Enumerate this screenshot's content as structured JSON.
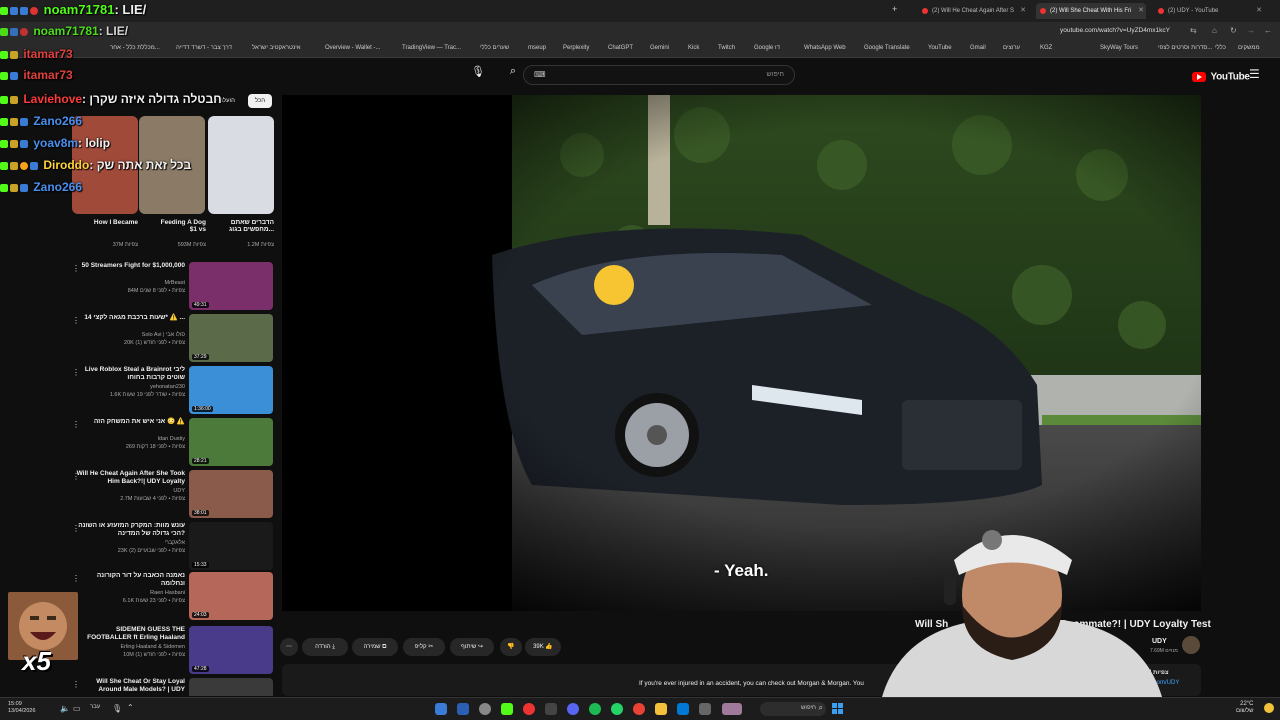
{
  "browser": {
    "tabs": [
      {
        "label": "(2) Will He Cheat Again After S"
      },
      {
        "label": "(2) Will She Cheat With His Fri"
      },
      {
        "label": "(2) UDY - YouTube"
      }
    ],
    "address": "youtube.com/watch?v=UyZD4mx1kcY",
    "bookmarks": [
      "ממשקים",
      "כללי",
      "סדרות וסרטים לצפי...",
      "SkyWay Tours",
      "KGZ",
      "ערוצים",
      "Gmail",
      "YouTube",
      "Google Translate",
      "WhatsApp Web",
      "Google דוּ",
      "Twitch",
      "Kick",
      "Gemini",
      "ChatGPT",
      "Perplexity",
      "mseup",
      "שערים כללי",
      "TradingView — Trac...",
      "Overview - Wallet -...",
      "אינטראקטיב ישראל",
      "דרך צבר - דשרד דדייה",
      "מכללת כלל - אחר..."
    ]
  },
  "youtube": {
    "logo": "YouTube",
    "search_placeholder": "חיפוש",
    "chip_all": "הכל",
    "chip_uploaded": "הועלה ע",
    "top_cards": [
      {
        "title": "How I Became",
        "views": "37M צפיות"
      },
      {
        "title": "Feeding A Dog $1 vs",
        "views": "593M צפיות"
      },
      {
        "title": "הדברים שאתם מחפשים בגוג...",
        "views": "1.2M צפיות"
      }
    ],
    "sidebar_videos": [
      {
        "title": "50 Streamers Fight for $1,000,000",
        "channel": "MrBeast",
        "meta": "84M צפיות • לפני 8 שנים",
        "duration": "49:31"
      },
      {
        "title": "14 שעות ברכבת מגאה לקצי* ⚠️ ...",
        "channel": "Solo Avi | סולו אבי",
        "meta": "20K צפיות • לפני חודש (1)",
        "duration": "37:29"
      },
      {
        "title": "Live Roblox Steal a Brainrot ליבי שוטים קרבות בחוחו",
        "channel": "yehonatan230",
        "meta": "1.6K צפיות • שודר לפני 19 שעות",
        "duration": "1:36:00"
      },
      {
        "title": "אני איש את המשחק הזה 😳 ⚠️",
        "channel": "Idan Dustiy",
        "meta": "269 צפיות • לפני 18 דקות",
        "duration": "28:21"
      },
      {
        "title": "Will He Cheat Again After She Took Him Back?!| UDY Loyalty",
        "channel": "UDY",
        "meta": "2.7M צפיות • לפני 4 שבועות",
        "duration": "38:01"
      },
      {
        "title": "עונש מוות: המקרק המזעזע או השונה הכי גדולה של המדינה?",
        "channel": "אלאקברי",
        "meta": "23K צפיות • לפני שבועיים (2)",
        "duration": "15:33"
      },
      {
        "title": "נאמנה הכאבה על דור הקורונה ונחלומה",
        "channel": "Raen Hasbani",
        "meta": "6.1K צפיות • לפני 23 שעות",
        "duration": "24:03"
      },
      {
        "title": "SIDEMEN GUESS THE FOOTBALLER ft Erling Haaland",
        "channel": "Erling Haaland & Sidemen",
        "meta": "10M צפיות • לפני חודש (1)",
        "duration": "47:28"
      },
      {
        "title": "Will She Cheat Or Stay Loyal Around Male Models? | UDY",
        "channel": "",
        "meta": "",
        "duration": ""
      }
    ],
    "video_title": "Will She Cheat With His Friend's Roommate?! | UDY Loyalty Test",
    "video_title_left": "Will Sh",
    "video_title_right": "Roommate?! | UDY Loyalty Test",
    "subtitle": "- Yeah.",
    "channel_name": "UDY",
    "subscribers": "7.69M מנויים",
    "views_line": "1.5M צפיות",
    "description_snippet": "If you're ever injured in an accident, you can check out Morgan & Morgan. You",
    "description_link": "ube.com/UDY",
    "actions": {
      "like_count": "39K",
      "share": "שיתוף",
      "clip": "קליפ",
      "save": "שמירה",
      "download": "הורדה",
      "more": "⋯"
    }
  },
  "chat_overlay": {
    "header_user": "noam71781",
    "header_text": ": LIE/",
    "header_user2": "noam71781",
    "header_text2": ": LIE/",
    "lines": [
      {
        "user": "itamar73",
        "msg": "",
        "color": "#e0413e"
      },
      {
        "user": "itamar73",
        "msg": "",
        "color": "#e0413e"
      },
      {
        "user": "Laviehove",
        "msg": ": חבטלה גדולה איזה שקרן",
        "color": "#ff3b3b"
      },
      {
        "user": "Zano266",
        "msg": "",
        "color": "#4a8ff0"
      },
      {
        "user": "yoav8m",
        "msg": ": lolip",
        "color": "#4a8ff0"
      },
      {
        "user": "Diroddo",
        "msg": ": בכל זאת אתה שק",
        "color": "#ffd23b"
      },
      {
        "user": "Zano266",
        "msg": "",
        "color": "#4a8ff0"
      }
    ],
    "emote_count": "x5"
  },
  "taskbar": {
    "time": "15:09",
    "date": "13/04/2026",
    "search_label": "חיפוש",
    "weather": "22°C",
    "weather_sub": "שלשום",
    "lang": "עבר"
  }
}
